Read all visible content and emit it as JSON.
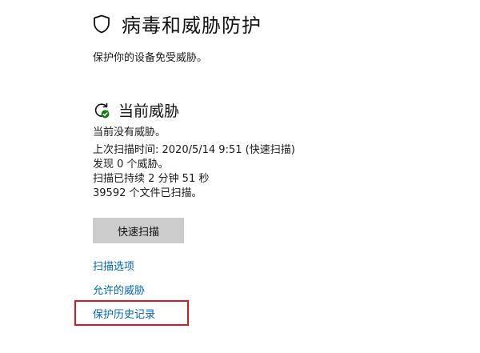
{
  "page": {
    "title": "病毒和威胁防护",
    "subtitle": "保护你的设备免受威胁。",
    "title_icon": "shield-icon"
  },
  "current_threats": {
    "title": "当前威胁",
    "icon": "refresh-check-icon",
    "status": "当前没有威胁。",
    "last_scan": "上次扫描时间: 2020/5/14 9:51 (快速扫描)",
    "threats_found": "发现 0 个威胁。",
    "scan_duration": "扫描已持续 2 分钟 51 秒",
    "files_scanned": "39592 个文件已扫描。"
  },
  "actions": {
    "quick_scan_label": "快速扫描",
    "scan_options_link": "扫描选项",
    "allowed_threats_link": "允许的威胁",
    "protection_history_link": "保护历史记录"
  },
  "colors": {
    "link": "#0066b4",
    "button_bg": "#cccccc",
    "highlight": "#e0161c",
    "status_ok": "#107c10"
  }
}
